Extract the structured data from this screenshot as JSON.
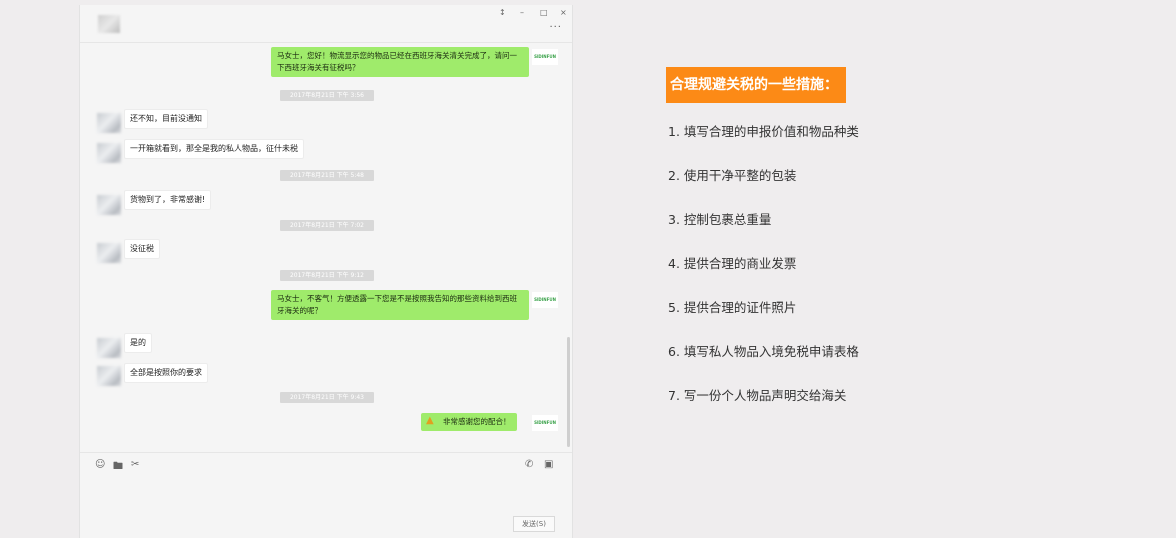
{
  "window": {
    "controls": [
      "↕",
      "–",
      "□",
      "×"
    ],
    "more": "···"
  },
  "messages": {
    "r1": "马女士，您好！物流显示您的物品已经在西班牙海关清关完成了，请问一下西班牙海关有征税吗？",
    "t1": "2017年8月21日 下午 3:56",
    "l1": "还不知，目前没通知",
    "l2": "一开箱就看到，那全是我的私人物品，征什未税",
    "t2": "2017年8月21日 下午 5:48",
    "l3": "货物到了，非常感谢!",
    "t3": "2017年8月21日 下午 7:02",
    "l4": "没征税",
    "t4": "2017年8月21日 下午 9:12",
    "r2": "马女士，不客气！方便透露一下您是不是按照我告知的那些资料给到西班牙海关的呢？",
    "l5": "是的",
    "l6": "全部是按照你的要求",
    "t5": "2017年8月21日 下午 9:43",
    "r3": "非常感谢您的配合！",
    "logo": "SIDINFUN"
  },
  "input": {
    "send_label": "发送(S)"
  },
  "tips": {
    "title": "合理规避关税的一些措施：",
    "items": [
      "1. 填写合理的申报价值和物品种类",
      "2. 使用干净平整的包装",
      "3. 控制包裹总重量",
      "4. 提供合理的商业发票",
      "5. 提供合理的证件照片",
      "6. 填写私人物品入境免税申请表格",
      "7. 写一份个人物品声明交给海关"
    ]
  },
  "colors": {
    "accent": "#fc8a16",
    "bubble_out": "#9feb6b",
    "bubble_in": "#ffffff",
    "background": "#efedee"
  }
}
